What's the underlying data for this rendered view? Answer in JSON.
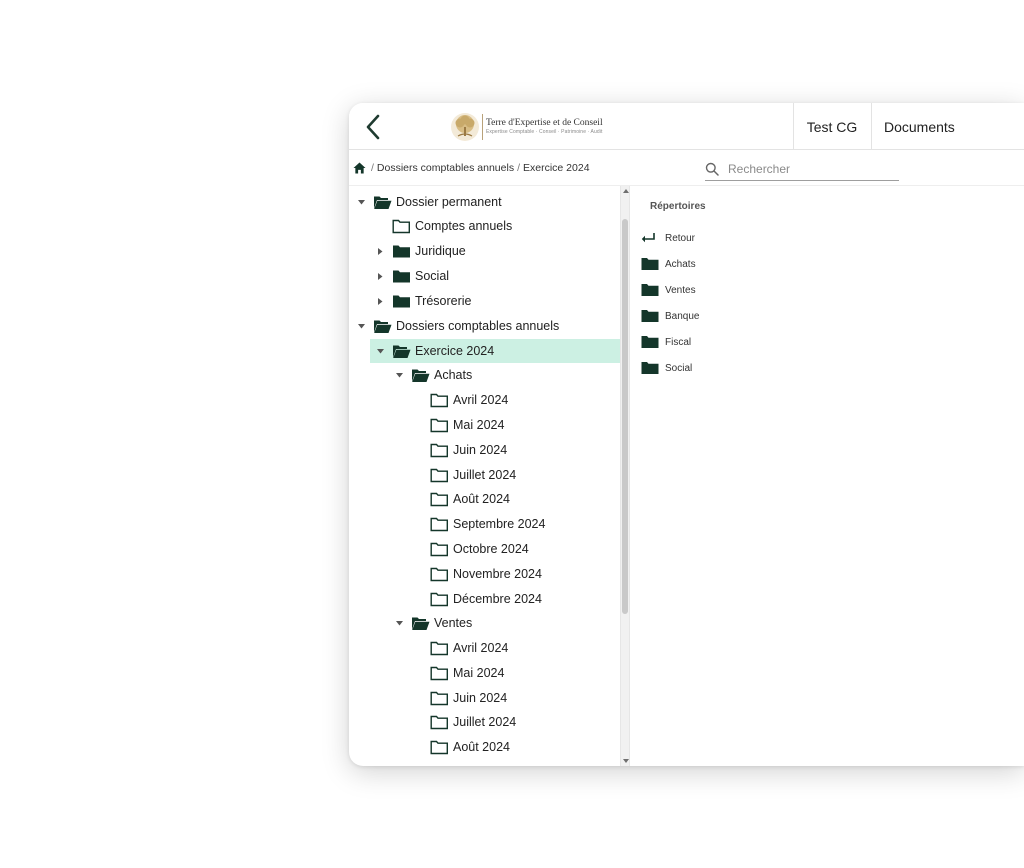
{
  "header": {
    "logo_title": "Terre d'Expertise et de Conseil",
    "logo_subtitle": "Expertise Comptable · Conseil · Patrimoine · Audit",
    "client": "Test CG",
    "page": "Documents"
  },
  "breadcrumb": {
    "items": [
      "Dossiers comptables annuels",
      "Exercice 2024"
    ]
  },
  "search": {
    "placeholder": "Rechercher"
  },
  "tree": {
    "dossier_permanent": "Dossier permanent",
    "comptes_annuels": "Comptes annuels",
    "juridique": "Juridique",
    "social": "Social",
    "tresorerie": "Trésorerie",
    "dossiers_comptables": "Dossiers comptables annuels",
    "exercice": "Exercice 2024",
    "achats": "Achats",
    "ventes": "Ventes",
    "achats_months": [
      "Avril 2024",
      "Mai 2024",
      "Juin 2024",
      "Juillet 2024",
      "Août 2024",
      "Septembre 2024",
      "Octobre 2024",
      "Novembre 2024",
      "Décembre 2024"
    ],
    "ventes_months": [
      "Avril 2024",
      "Mai 2024",
      "Juin 2024",
      "Juillet 2024",
      "Août 2024"
    ]
  },
  "directories": {
    "title": "Répertoires",
    "back": "Retour",
    "items": [
      "Achats",
      "Ventes",
      "Banque",
      "Fiscal",
      "Social"
    ]
  },
  "colors": {
    "accent_dark": "#14362a",
    "selected_bg": "#ccf0e3",
    "logo_gold": "#c8a96a"
  }
}
